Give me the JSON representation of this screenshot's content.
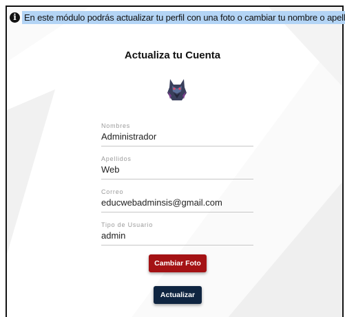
{
  "info": {
    "icon": "info-circle-icon",
    "message": "En este módulo podrás actualizar tu perfil con una foto o cambiar tu nombre o apellido."
  },
  "card": {
    "title": "Actualiza tu Cuenta",
    "avatar_icon": "wolf-avatar-icon"
  },
  "fields": [
    {
      "label": "Nombres",
      "value": "Administrador"
    },
    {
      "label": "Apellidos",
      "value": "Web"
    },
    {
      "label": "Correo",
      "value": "educwebadminsis@gmail.com"
    },
    {
      "label": "Tipo de Usuario",
      "value": "admin"
    }
  ],
  "buttons": {
    "change_photo": "Cambiar Foto",
    "update": "Actualizar"
  },
  "colors": {
    "info_highlight": "#b3d4f5",
    "change_photo_button": "#a41214",
    "update_button": "#0f2541"
  }
}
